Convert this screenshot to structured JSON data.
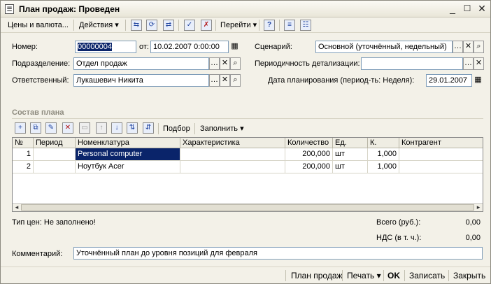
{
  "window": {
    "title": "План продаж: Проведен"
  },
  "toolbar": {
    "prices_label": "Цены и валюта...",
    "actions_label": "Действия",
    "goto_label": "Перейти",
    "help_label": "?"
  },
  "form": {
    "number_label": "Номер:",
    "number_value": "00000004",
    "from_label": "от:",
    "date_value": "10.02.2007  0:00:00",
    "scenario_label": "Сценарий:",
    "scenario_value": "Основной (уточнённый, недельный)",
    "division_label": "Подразделение:",
    "division_value": "Отдел продаж",
    "periodicity_label": "Периодичность детализации:",
    "periodicity_value": "",
    "responsible_label": "Ответственный:",
    "responsible_value": "Лукашевич Никита",
    "planning_date_label": "Дата планирования (период-ть: Неделя):",
    "planning_date_value": "29.01.2007"
  },
  "plan": {
    "section_title": "Состав плана",
    "select_label": "Подбор",
    "fill_label": "Заполнить",
    "columns": [
      "№",
      "Период",
      "Номенклатура",
      "Характеристика",
      "Количество",
      "Ед.",
      "К.",
      "Контрагент"
    ],
    "rows": [
      {
        "n": "1",
        "period": "",
        "item": "Personal computer",
        "characteristic": "",
        "qty": "200,000",
        "unit": "шт",
        "k": "1,000",
        "counterparty": ""
      },
      {
        "n": "2",
        "period": "",
        "item": "Ноутбук Acer",
        "characteristic": "",
        "qty": "200,000",
        "unit": "шт",
        "k": "1,000",
        "counterparty": ""
      }
    ]
  },
  "summary": {
    "price_type_text": "Тип цен: Не заполнено!",
    "total_label": "Всего (руб.):",
    "total_value": "0,00",
    "vat_label": "НДС (в т. ч.):",
    "vat_value": "0,00"
  },
  "comment": {
    "label": "Комментарий:",
    "value": "Уточнённый план до уровня позиций для февраля"
  },
  "footer": {
    "plan_label": "План продаж",
    "print_label": "Печать",
    "ok_label": "OK",
    "save_label": "Записать",
    "close_label": "Закрыть"
  }
}
